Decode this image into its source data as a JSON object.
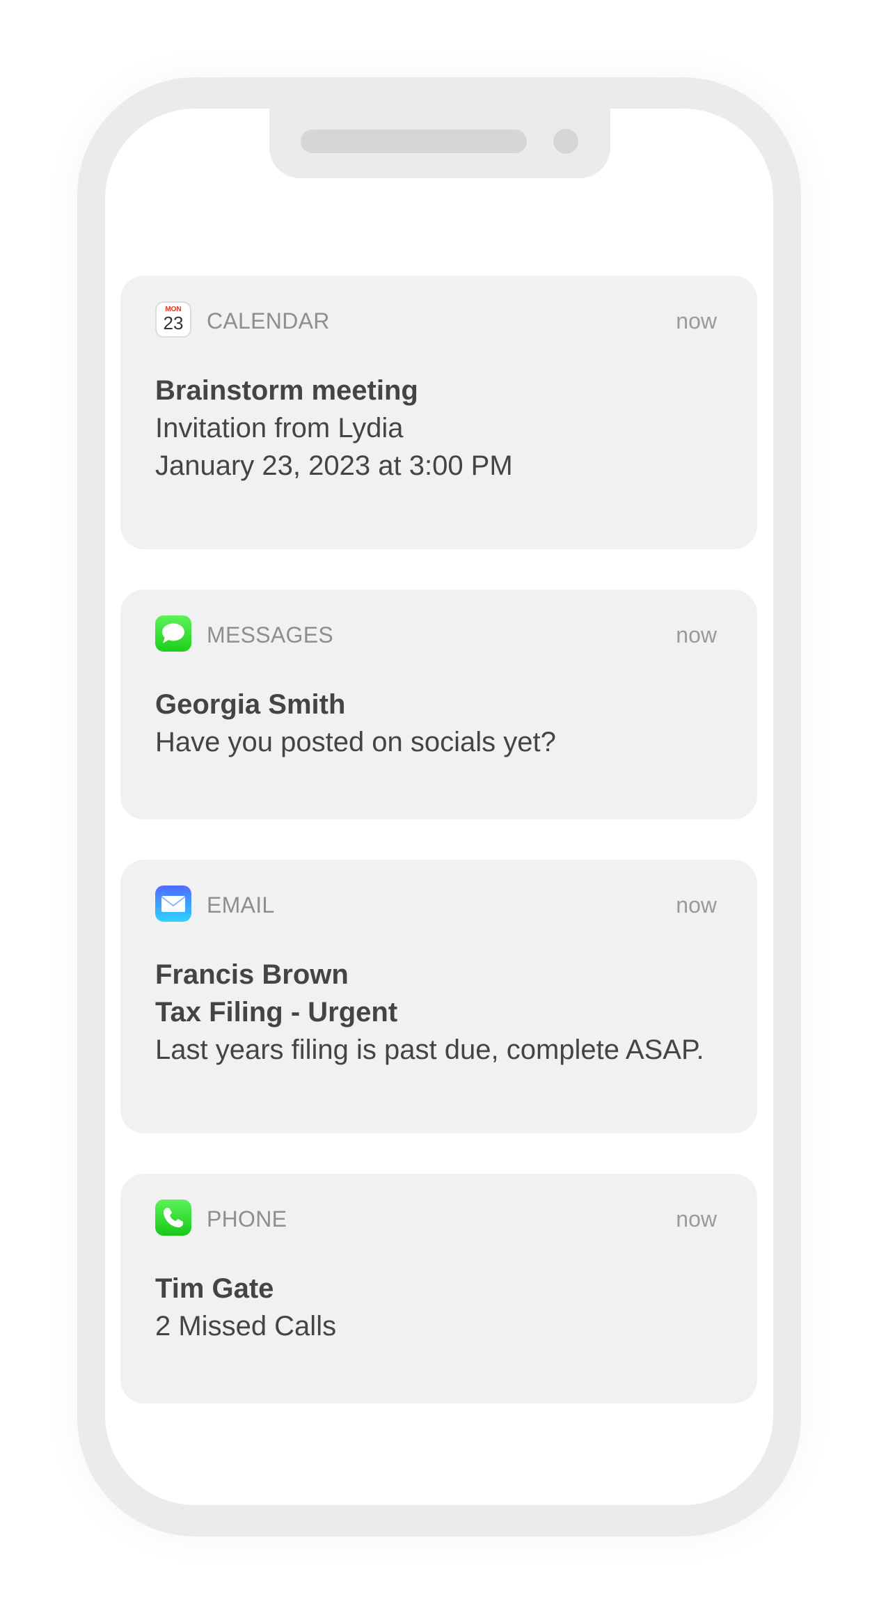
{
  "notifications": [
    {
      "app": "CALENDAR",
      "icon": "calendar-icon",
      "icon_day": "MON",
      "icon_date": "23",
      "time": "now",
      "lines_bold": [
        "Brainstorm meeting"
      ],
      "lines": [
        "Invitation from Lydia",
        "January 23, 2023 at 3:00 PM"
      ]
    },
    {
      "app": "MESSAGES",
      "icon": "message-bubble-icon",
      "time": "now",
      "lines_bold": [
        "Georgia Smith"
      ],
      "lines": [
        "Have you posted on socials yet?"
      ]
    },
    {
      "app": "EMAIL",
      "icon": "envelope-icon",
      "time": "now",
      "lines_bold": [
        "Francis Brown",
        "Tax Filing - Urgent"
      ],
      "lines": [
        "Last years filing is past due, complete ASAP."
      ]
    },
    {
      "app": "PHONE",
      "icon": "phone-handset-icon",
      "time": "now",
      "lines_bold": [
        "Tim Gate"
      ],
      "lines": [
        "2 Missed Calls"
      ]
    }
  ],
  "colors": {
    "frame": "#ebebeb",
    "card": "#f1f1f1",
    "text": "#444444",
    "muted": "#8e8e8e",
    "calendar_red": "#e0341f",
    "messages_green": "#1ccf1a",
    "mail_blue": "#2ed3ff"
  }
}
